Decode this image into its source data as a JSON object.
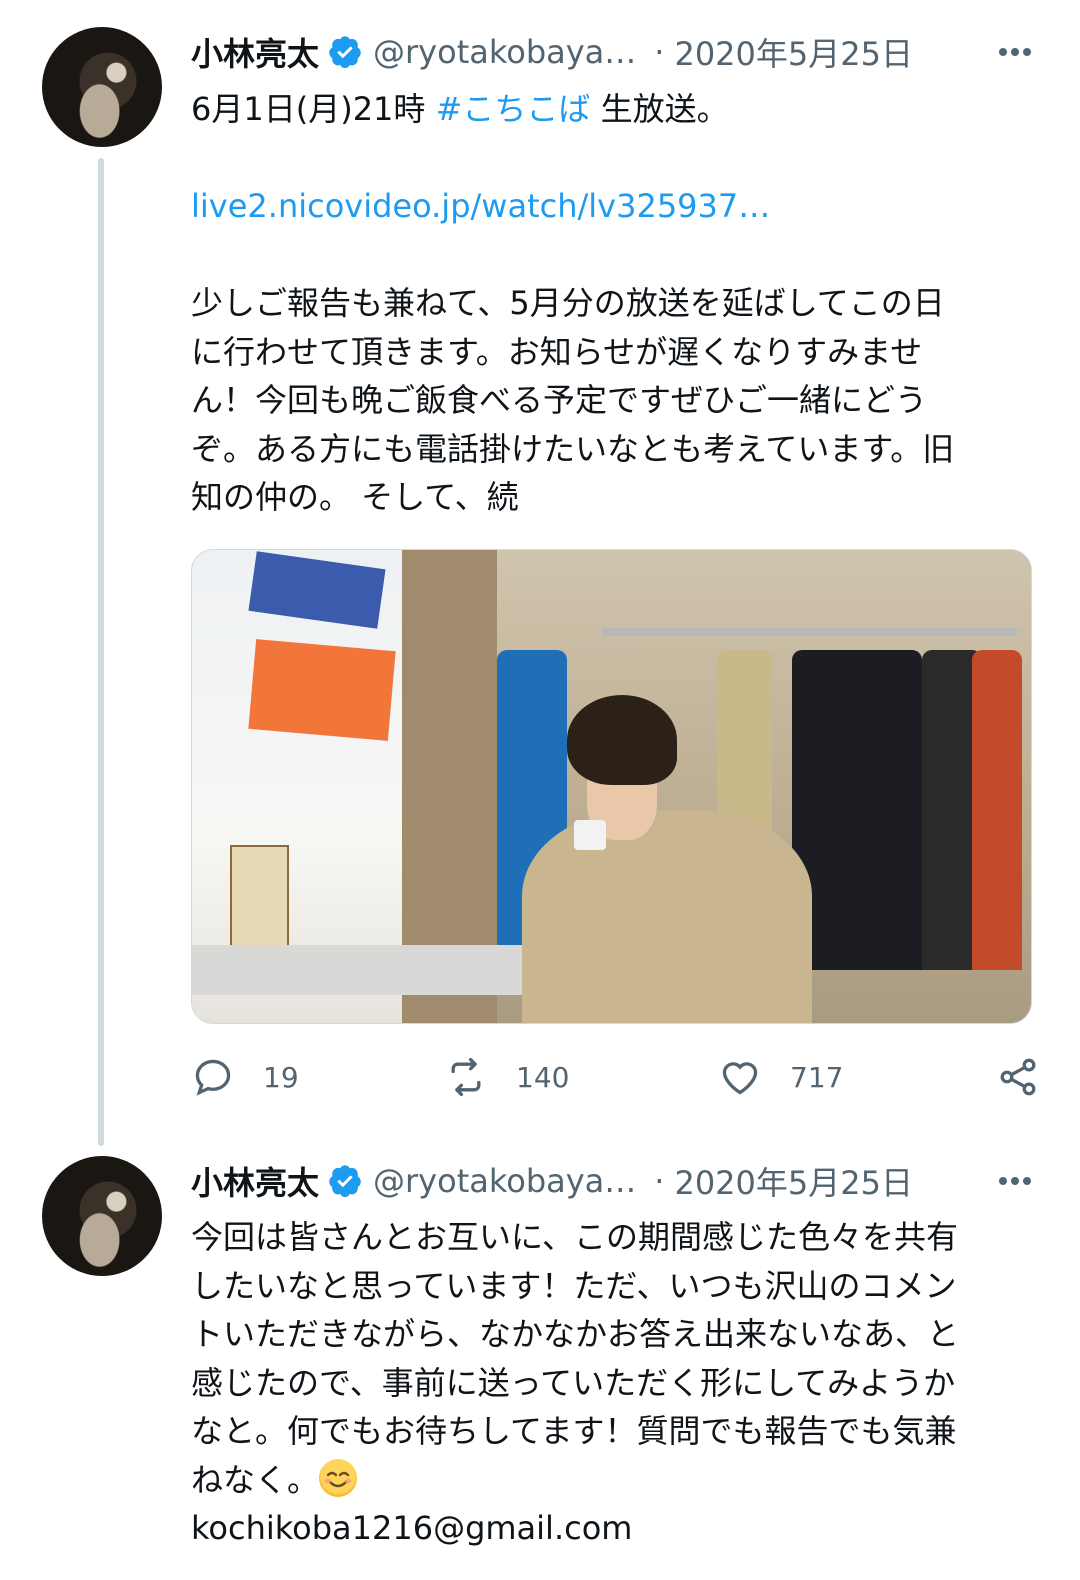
{
  "colors": {
    "link": "#1d9bf0",
    "verified": "#1d9bf0",
    "muted": "#536471",
    "text": "#0f1419",
    "thread_line": "#cfd9de"
  },
  "tweets": [
    {
      "author_name": "小林亮太",
      "handle": "@ryotakobaya…",
      "separator": "·",
      "date": "2020年5月25日",
      "lines": [
        {
          "segments": [
            {
              "text": "6月1日(月)21時 "
            },
            {
              "text": "#こちこば",
              "link": true
            },
            {
              "text": " 生放送。"
            }
          ]
        },
        {
          "segments": []
        },
        {
          "segments": [
            {
              "text": "live2.nicovideo.jp/watch/lv325937…",
              "link": true
            }
          ]
        },
        {
          "segments": []
        },
        {
          "segments": [
            {
              "text": "少しご報告も兼ねて、5月分の放送を延ばしてこの日"
            }
          ]
        },
        {
          "segments": [
            {
              "text": "に行わせて頂きます。お知らせが遅くなりすみませ"
            }
          ]
        },
        {
          "segments": [
            {
              "text": "ん！今回も晩ご飯食べる予定ですぜひご一緒にどう"
            }
          ]
        },
        {
          "segments": [
            {
              "text": "ぞ。ある方にも電話掛けたいなとも考えています。旧"
            }
          ]
        },
        {
          "segments": [
            {
              "text": "知の仲の。 そして、続"
            }
          ]
        }
      ],
      "stats": {
        "replies": "19",
        "retweets": "140",
        "likes": "717"
      }
    },
    {
      "author_name": "小林亮太",
      "handle": "@ryotakobaya…",
      "separator": "·",
      "date": "2020年5月25日",
      "lines": [
        {
          "segments": [
            {
              "text": "今回は皆さんとお互いに、この期間感じた色々を共有"
            }
          ]
        },
        {
          "segments": [
            {
              "text": "したいなと思っています！ただ、いつも沢山のコメン"
            }
          ]
        },
        {
          "segments": [
            {
              "text": "トいただきながら、なかなかお答え出来ないなあ、と"
            }
          ]
        },
        {
          "segments": [
            {
              "text": "感じたので、事前に送っていただく形にしてみようか"
            }
          ]
        },
        {
          "segments": [
            {
              "text": "なと。何でもお待ちしてます！質問でも報告でも気兼"
            }
          ]
        },
        {
          "segments": [
            {
              "text": "ねなく。"
            },
            {
              "emoji": "smiling-face-emoji"
            }
          ]
        },
        {
          "segments": [
            {
              "text": "kochikoba1216@gmail.com"
            }
          ]
        }
      ]
    }
  ]
}
